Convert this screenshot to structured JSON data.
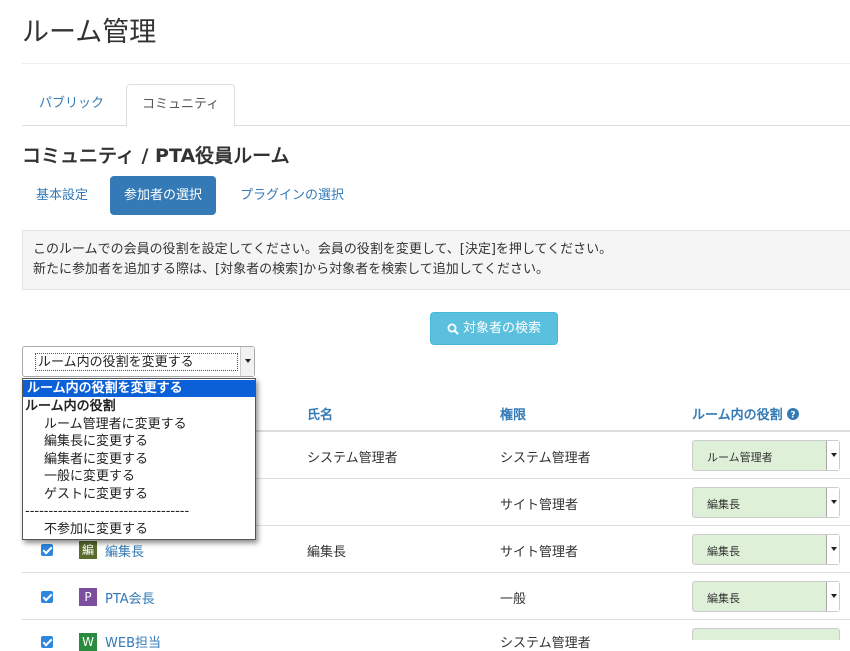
{
  "page": {
    "title": "ルーム管理"
  },
  "tabs": [
    {
      "label": "パブリック",
      "active": false
    },
    {
      "label": "コミュニティ",
      "active": true
    }
  ],
  "room_heading": "コミュニティ / PTA役員ルーム",
  "subnav": [
    {
      "label": "基本設定",
      "active": false
    },
    {
      "label": "参加者の選択",
      "active": true
    },
    {
      "label": "プラグインの選択",
      "active": false
    }
  ],
  "info": {
    "line1": "このルームでの会員の役割を設定してください。会員の役割を変更して、[決定]を押してください。",
    "line2": "新たに参加者を追加する際は、[対象者の検索]から対象者を検索して追加してください。"
  },
  "search_button": {
    "label": "対象者の検索"
  },
  "bulk_select": {
    "value": "ルーム内の役割を変更する",
    "options": {
      "selected": "ルーム内の役割を変更する",
      "group": "ルーム内の役割",
      "items": [
        "ルーム管理者に変更する",
        "編集長に変更する",
        "編集者に変更する",
        "一般に変更する",
        "ゲストに変更する"
      ],
      "separator": "-----------------------------------",
      "leave": "不参加に変更する"
    }
  },
  "table": {
    "headers": {
      "name": "氏名",
      "authority": "権限",
      "role": "ルーム内の役割"
    },
    "rows": [
      {
        "avatar_text": "",
        "avatar_color": "",
        "user": "",
        "name": "システム管理者",
        "authority": "システム管理者",
        "role": "ルーム管理者"
      },
      {
        "avatar_text": "",
        "avatar_color": "",
        "user": "",
        "name": "",
        "authority": "サイト管理者",
        "role": "編集長"
      },
      {
        "avatar_text": "編",
        "avatar_color": "#5a6b2e",
        "user": "編集長",
        "name": "編集長",
        "authority": "サイト管理者",
        "role": "編集長"
      },
      {
        "avatar_text": "P",
        "avatar_color": "#7b4f9d",
        "user": "PTA会長",
        "name": "",
        "authority": "一般",
        "role": "編集長"
      },
      {
        "avatar_text": "W",
        "avatar_color": "#2a8a3e",
        "user": "WEB担当",
        "name": "",
        "authority": "システム管理者",
        "role": ""
      }
    ]
  },
  "colors": {
    "link": "#337ab7",
    "primary": "#337ab7",
    "info": "#5bc0de",
    "role_bg": "#dff0d8"
  }
}
